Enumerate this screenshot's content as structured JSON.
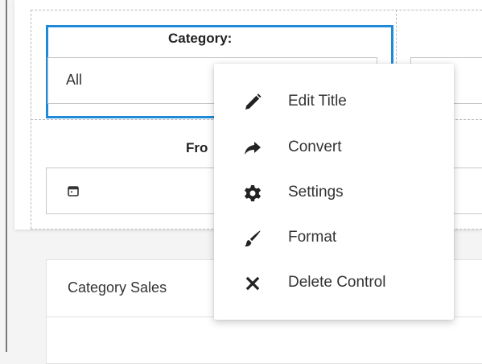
{
  "filters": {
    "category_label": "Category:",
    "category_value": "All",
    "from_label": "Fro"
  },
  "chart_card": {
    "title": "Category Sales"
  },
  "context_menu": {
    "items": [
      {
        "label": "Edit Title",
        "icon": "pencil-icon"
      },
      {
        "label": "Convert",
        "icon": "share-arrow-icon"
      },
      {
        "label": "Settings",
        "icon": "gear-icon"
      },
      {
        "label": "Format",
        "icon": "brush-icon"
      },
      {
        "label": "Delete Control",
        "icon": "close-icon"
      }
    ]
  },
  "colors": {
    "selection": "#1f8ad8",
    "icon": "#222222"
  }
}
